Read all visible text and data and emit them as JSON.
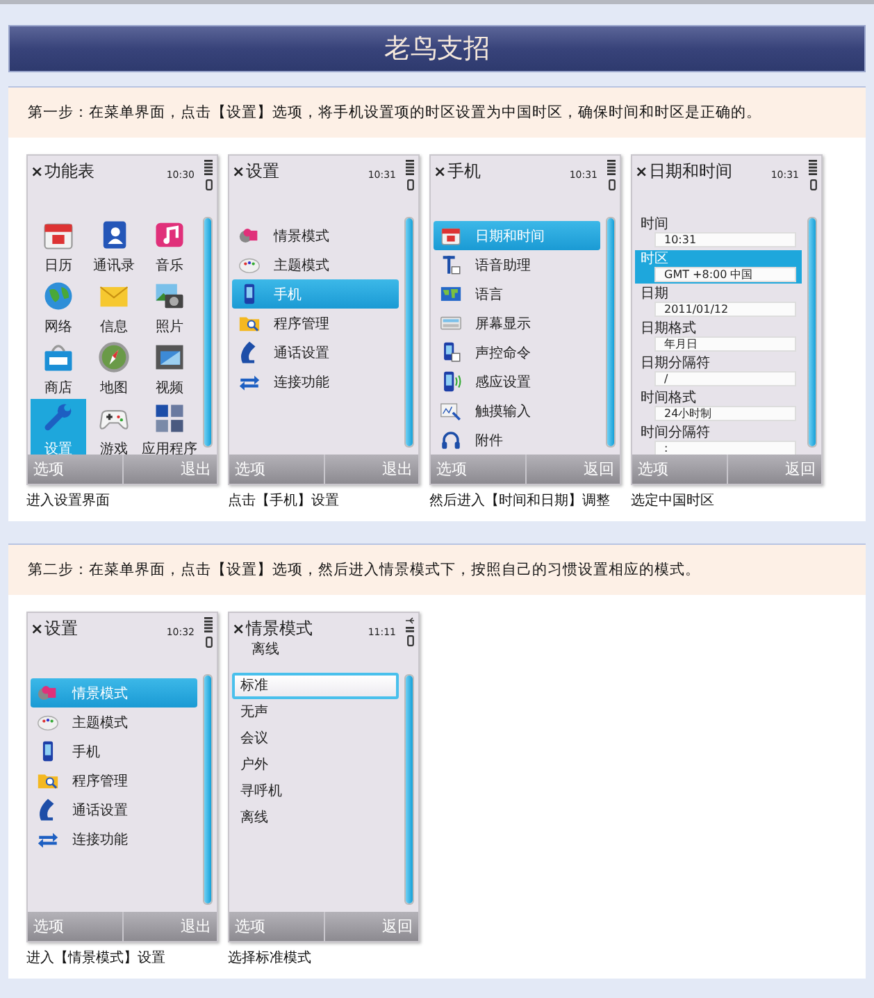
{
  "header": {
    "title": "老鸟支招"
  },
  "steps": [
    {
      "instruction": "第一步：在菜单界面，点击【设置】选项，将手机设置项的时区设置为中国时区，确保时间和时区是正确的。",
      "screens": [
        {
          "kind": "grid",
          "close": "×",
          "title": "功能表",
          "time": "10:30",
          "usb": false,
          "softkeys": {
            "left": "选项",
            "right": "退出"
          },
          "caption": "进入设置界面",
          "items": [
            {
              "label": "日历",
              "selected": false
            },
            {
              "label": "通讯录",
              "selected": false
            },
            {
              "label": "音乐",
              "selected": false
            },
            {
              "label": "网络",
              "selected": false
            },
            {
              "label": "信息",
              "selected": false
            },
            {
              "label": "照片",
              "selected": false
            },
            {
              "label": "商店",
              "selected": false
            },
            {
              "label": "地图",
              "selected": false
            },
            {
              "label": "视频",
              "selected": false
            },
            {
              "label": "设置",
              "selected": true
            },
            {
              "label": "游戏",
              "selected": false
            },
            {
              "label": "应用程序",
              "selected": false
            }
          ]
        },
        {
          "kind": "list",
          "close": "×",
          "title": "设置",
          "time": "10:31",
          "usb": false,
          "softkeys": {
            "left": "选项",
            "right": "退出"
          },
          "caption": "点击【手机】设置",
          "items": [
            {
              "label": "情景模式",
              "selected": false
            },
            {
              "label": "主题模式",
              "selected": false
            },
            {
              "label": "手机",
              "selected": true
            },
            {
              "label": "程序管理",
              "selected": false
            },
            {
              "label": "通话设置",
              "selected": false
            },
            {
              "label": "连接功能",
              "selected": false
            }
          ]
        },
        {
          "kind": "list",
          "close": "×",
          "title": "手机",
          "time": "10:31",
          "usb": false,
          "softkeys": {
            "left": "选项",
            "right": "返回"
          },
          "caption": "然后进入【时间和日期】调整",
          "items": [
            {
              "label": "日期和时间",
              "selected": true
            },
            {
              "label": "语音助理",
              "selected": false
            },
            {
              "label": "语言",
              "selected": false
            },
            {
              "label": "屏幕显示",
              "selected": false
            },
            {
              "label": "声控命令",
              "selected": false
            },
            {
              "label": "感应设置",
              "selected": false
            },
            {
              "label": "触摸输入",
              "selected": false
            },
            {
              "label": "附件",
              "selected": false
            }
          ]
        },
        {
          "kind": "form",
          "close": "×",
          "title": "日期和时间",
          "time": "10:31",
          "usb": false,
          "softkeys": {
            "left": "选项",
            "right": "返回"
          },
          "caption": "选定中国时区",
          "items": [
            {
              "label": "时间",
              "value": "10:31",
              "selected": false
            },
            {
              "label": "时区",
              "value": "GMT +8:00  中国",
              "selected": true
            },
            {
              "label": "日期",
              "value": "2011/01/12",
              "selected": false
            },
            {
              "label": "日期格式",
              "value": "年月日",
              "selected": false
            },
            {
              "label": "日期分隔符",
              "value": "/",
              "selected": false
            },
            {
              "label": "时间格式",
              "value": "24小时制",
              "selected": false
            },
            {
              "label": "时间分隔符",
              "value": ":",
              "selected": false
            }
          ]
        }
      ]
    },
    {
      "instruction": "第二步：在菜单界面，点击【设置】选项，然后进入情景模式下，按照自己的习惯设置相应的模式。",
      "screens": [
        {
          "kind": "list",
          "close": "×",
          "title": "设置",
          "time": "10:32",
          "usb": false,
          "softkeys": {
            "left": "选项",
            "right": "退出"
          },
          "caption": "进入【情景模式】设置",
          "items": [
            {
              "label": "情景模式",
              "selected": true
            },
            {
              "label": "主题模式",
              "selected": false
            },
            {
              "label": "手机",
              "selected": false
            },
            {
              "label": "程序管理",
              "selected": false
            },
            {
              "label": "通话设置",
              "selected": false
            },
            {
              "label": "连接功能",
              "selected": false
            }
          ]
        },
        {
          "kind": "plain",
          "close": "×",
          "title": "情景模式",
          "subtitle": "离线",
          "time": "11:11",
          "usb": true,
          "softkeys": {
            "left": "选项",
            "right": "返回"
          },
          "caption": "选择标准模式",
          "items": [
            {
              "label": "标准",
              "selected": true
            },
            {
              "label": "无声",
              "selected": false
            },
            {
              "label": "会议",
              "selected": false
            },
            {
              "label": "户外",
              "selected": false
            },
            {
              "label": "寻呼机",
              "selected": false
            },
            {
              "label": "离线",
              "selected": false
            }
          ]
        }
      ]
    }
  ]
}
